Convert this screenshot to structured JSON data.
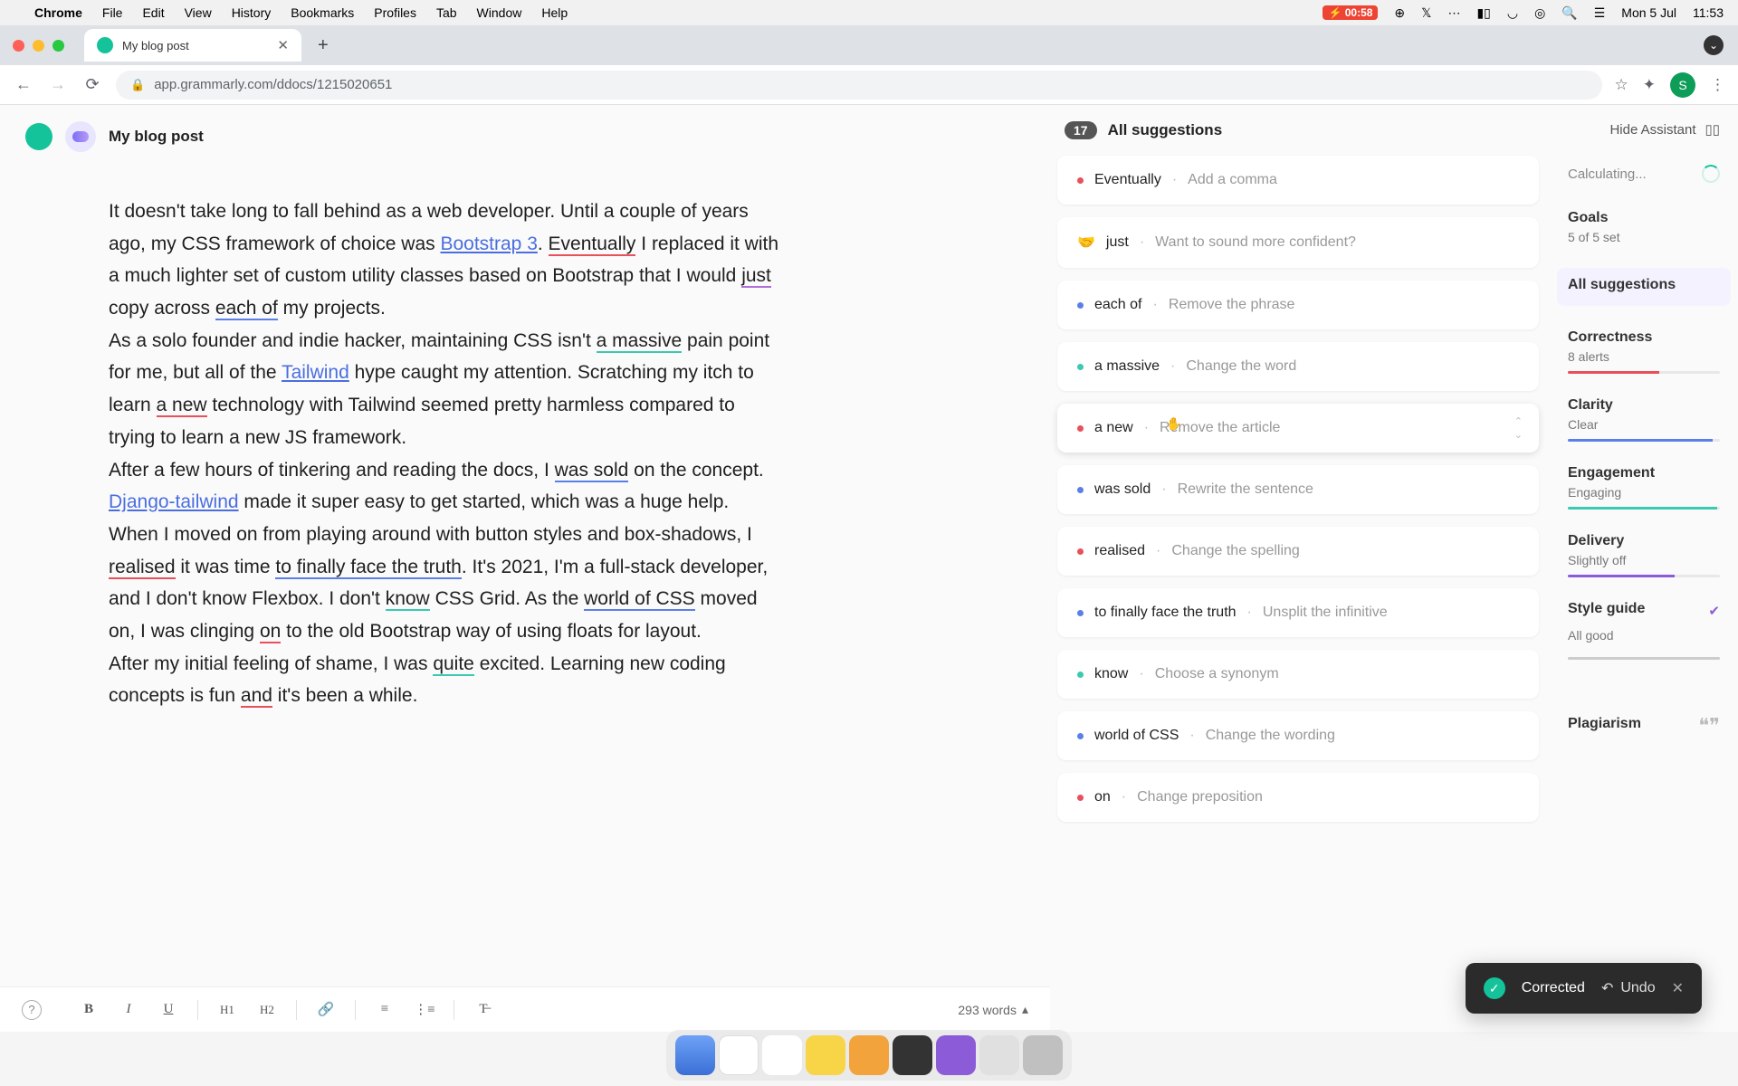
{
  "menubar": {
    "apple": "",
    "app": "Chrome",
    "items": [
      "File",
      "Edit",
      "View",
      "History",
      "Bookmarks",
      "Profiles",
      "Tab",
      "Window",
      "Help"
    ],
    "battery": "00:58",
    "date": "Mon 5 Jul",
    "time": "11:53"
  },
  "browser": {
    "tab_title": "My blog post",
    "url": "app.grammarly.com/ddocs/1215020651",
    "avatar_initial": "S"
  },
  "doc": {
    "title": "My blog post",
    "editor": {
      "p1_a": "It doesn't take long to fall behind as a web developer. Until a couple of years ago, my CSS framework of choice was ",
      "p1_link1": "Bootstrap 3",
      "p1_b": ". ",
      "p1_eventually": "Eventually",
      "p1_c": " I replaced it with a much lighter set of custom utility classes based on Bootstrap that I would ",
      "p1_just": "just",
      "p1_d": " copy across ",
      "p1_eachof": "each of",
      "p1_e": " my projects.",
      "p2_a": "As a solo founder and indie hacker, maintaining CSS isn't ",
      "p2_amassive": "a massive",
      "p2_b": " pain point for me, but all of the ",
      "p2_link": "Tailwind",
      "p2_c": " hype caught my attention. Scratching my itch to learn ",
      "p2_anew": "a new",
      "p2_d": " technology with Tailwind seemed pretty harmless compared to trying to learn a new JS framework.",
      "p3_a": "After a few hours of tinkering and reading the docs, I ",
      "p3_wassold": "was sold",
      "p3_b": " on the concept. ",
      "p3_link": "Django-tailwind",
      "p3_c": " made it super easy to get started, which was a huge help.",
      "p4_a": "When I moved on from playing around with button styles and box-shadows, I ",
      "p4_realised": "realised",
      "p4_b": " it was time ",
      "p4_tofinally": "to finally face the truth",
      "p4_c": ". It's 2021, I'm a full-stack developer, and I don't know Flexbox. I don't ",
      "p4_know": "know",
      "p4_d": " CSS Grid. As the ",
      "p4_worldcss": "world of CSS",
      "p4_e": " moved on, I was clinging ",
      "p4_on": "on",
      "p4_f": " to the old Bootstrap way of using floats for layout.",
      "p5_a": "After my initial feeling of shame, I was ",
      "p5_quite": "quite",
      "p5_b": " excited. Learning new coding concepts is fun ",
      "p5_and": "and",
      "p5_c": " it's been a while."
    },
    "wordcount": "293 words"
  },
  "suggestions": {
    "header": "All suggestions",
    "count": "17",
    "items": [
      {
        "color": "d-red",
        "term": "Eventually",
        "desc": "Add a comma"
      },
      {
        "emoji": "🤝",
        "term": "just",
        "desc": "Want to sound more confident?"
      },
      {
        "color": "d-blue",
        "term": "each of",
        "desc": "Remove the phrase"
      },
      {
        "color": "d-teal",
        "term": "a massive",
        "desc": "Change the word"
      },
      {
        "color": "d-red",
        "term": "a new",
        "desc": "Remove the article",
        "active": true
      },
      {
        "color": "d-blue",
        "term": "was sold",
        "desc": "Rewrite the sentence"
      },
      {
        "color": "d-red",
        "term": "realised",
        "desc": "Change the spelling"
      },
      {
        "color": "d-blue",
        "term": "to finally face the truth",
        "desc": "Unsplit the infinitive"
      },
      {
        "color": "d-teal",
        "term": "know",
        "desc": "Choose a synonym"
      },
      {
        "color": "d-blue",
        "term": "world of CSS",
        "desc": "Change the wording"
      },
      {
        "color": "d-red",
        "term": "on",
        "desc": "Change preposition"
      }
    ]
  },
  "sidebar": {
    "hide": "Hide Assistant",
    "calculating": "Calculating...",
    "goals_title": "Goals",
    "goals_sub": "5 of 5 set",
    "all_suggestions": "All suggestions",
    "correctness_title": "Correctness",
    "correctness_sub": "8 alerts",
    "clarity_title": "Clarity",
    "clarity_sub": "Clear",
    "engagement_title": "Engagement",
    "engagement_sub": "Engaging",
    "delivery_title": "Delivery",
    "delivery_sub": "Slightly off",
    "style_title": "Style guide",
    "style_sub": "All good",
    "plagiarism": "Plagiarism"
  },
  "toast": {
    "label": "Corrected",
    "undo": "Undo"
  },
  "toolbar": {
    "bold": "B",
    "italic": "I",
    "underline": "U",
    "h1": "H1",
    "h2": "H2"
  }
}
